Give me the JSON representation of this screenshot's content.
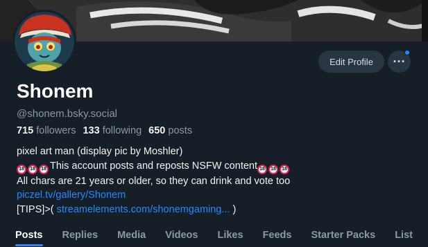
{
  "profile": {
    "display_name": "Shonem",
    "handle": "@shonem.bsky.social",
    "followers_count": "715",
    "followers_label": "followers",
    "following_count": "133",
    "following_label": "following",
    "posts_count": "650",
    "posts_label": "posts"
  },
  "actions": {
    "edit_profile_label": "Edit Profile",
    "more_label": "···"
  },
  "bio": {
    "line1": "pixel art man (display pic by Moshler)",
    "badge": "18",
    "line2_text": "This account posts and reposts NSFW content",
    "line3": "All chars are 21 years or older, so they can drink and vote too",
    "link1": "piczel.tv/gallery/Shonem",
    "line5_prefix": "[TIPS]>( ",
    "link2": "streamelements.com/shonemgaming...",
    "line5_suffix": " )"
  },
  "tabs": [
    {
      "label": "Posts",
      "active": true
    },
    {
      "label": "Replies"
    },
    {
      "label": "Media"
    },
    {
      "label": "Videos"
    },
    {
      "label": "Likes"
    },
    {
      "label": "Feeds"
    },
    {
      "label": "Starter Packs"
    },
    {
      "label": "List"
    }
  ],
  "colors": {
    "background": "#161e27",
    "accent": "#208bfe",
    "muted_text": "#8b98a5",
    "button_bg": "#2a3542",
    "nsfw_badge_ring": "#e0245e"
  }
}
